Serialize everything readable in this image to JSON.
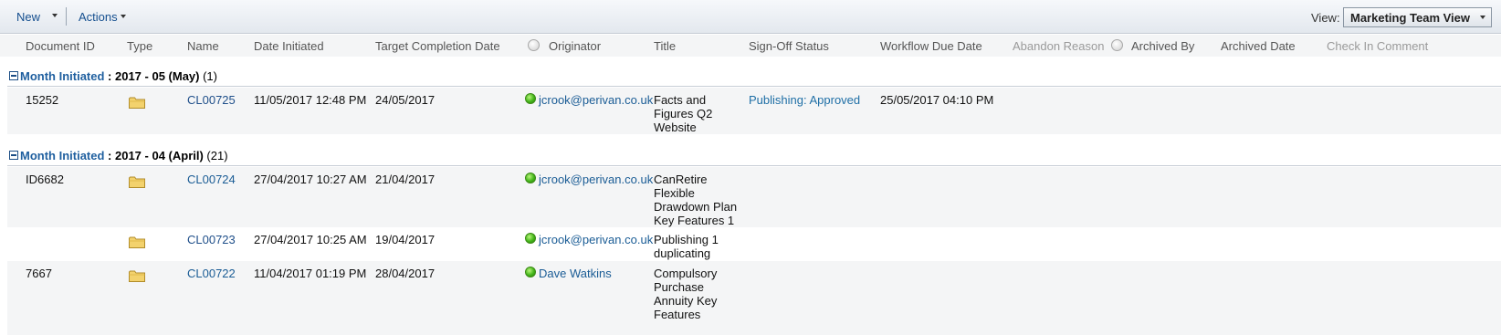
{
  "toolbar": {
    "new_label": "New",
    "actions_label": "Actions",
    "view_label": "View:",
    "view_value": "Marketing Team View"
  },
  "columns": {
    "document_id": "Document ID",
    "type": "Type",
    "name": "Name",
    "date_initiated": "Date Initiated",
    "target_completion": "Target Completion Date",
    "originator": "Originator",
    "title": "Title",
    "signoff_status": "Sign-Off Status",
    "workflow_due": "Workflow Due Date",
    "abandon_reason": "Abandon Reason",
    "archived_by": "Archived By",
    "archived_date": "Archived Date",
    "check_in_comment": "Check In Comment"
  },
  "groups": [
    {
      "key": "Month Initiated",
      "value": " : 2017 - 05 (May)",
      "count": " (1)",
      "rows": [
        {
          "document_id": "15252",
          "name": "CL00725",
          "date_initiated": "11/05/2017 12:48 PM",
          "target_completion": "24/05/2017",
          "originator": "jcrook@perivan.co.uk",
          "title": "Facts and Figures Q2 Website",
          "signoff_status": "Publishing: Approved",
          "workflow_due": "25/05/2017 04:10 PM"
        }
      ]
    },
    {
      "key": "Month Initiated",
      "value": " : 2017 - 04 (April)",
      "count": " (21)",
      "rows": [
        {
          "document_id": "ID6682",
          "name": "CL00724",
          "date_initiated": "27/04/2017 10:27 AM",
          "target_completion": "21/04/2017",
          "originator": "jcrook@perivan.co.uk",
          "title": "CanRetire Flexible Drawdown Plan Key Features  1",
          "signoff_status": "",
          "workflow_due": ""
        },
        {
          "document_id": "",
          "name": "CL00723",
          "date_initiated": "27/04/2017 10:25 AM",
          "target_completion": "19/04/2017",
          "originator": "jcrook@perivan.co.uk",
          "title": "Publishing 1 duplicating",
          "signoff_status": "",
          "workflow_due": ""
        },
        {
          "document_id": "7667",
          "name": "CL00722",
          "date_initiated": "11/04/2017 01:19 PM",
          "target_completion": "28/04/2017",
          "originator": "Dave Watkins",
          "title": "Compulsory Purchase Annuity Key Features",
          "signoff_status": "",
          "workflow_due": ""
        }
      ]
    }
  ]
}
